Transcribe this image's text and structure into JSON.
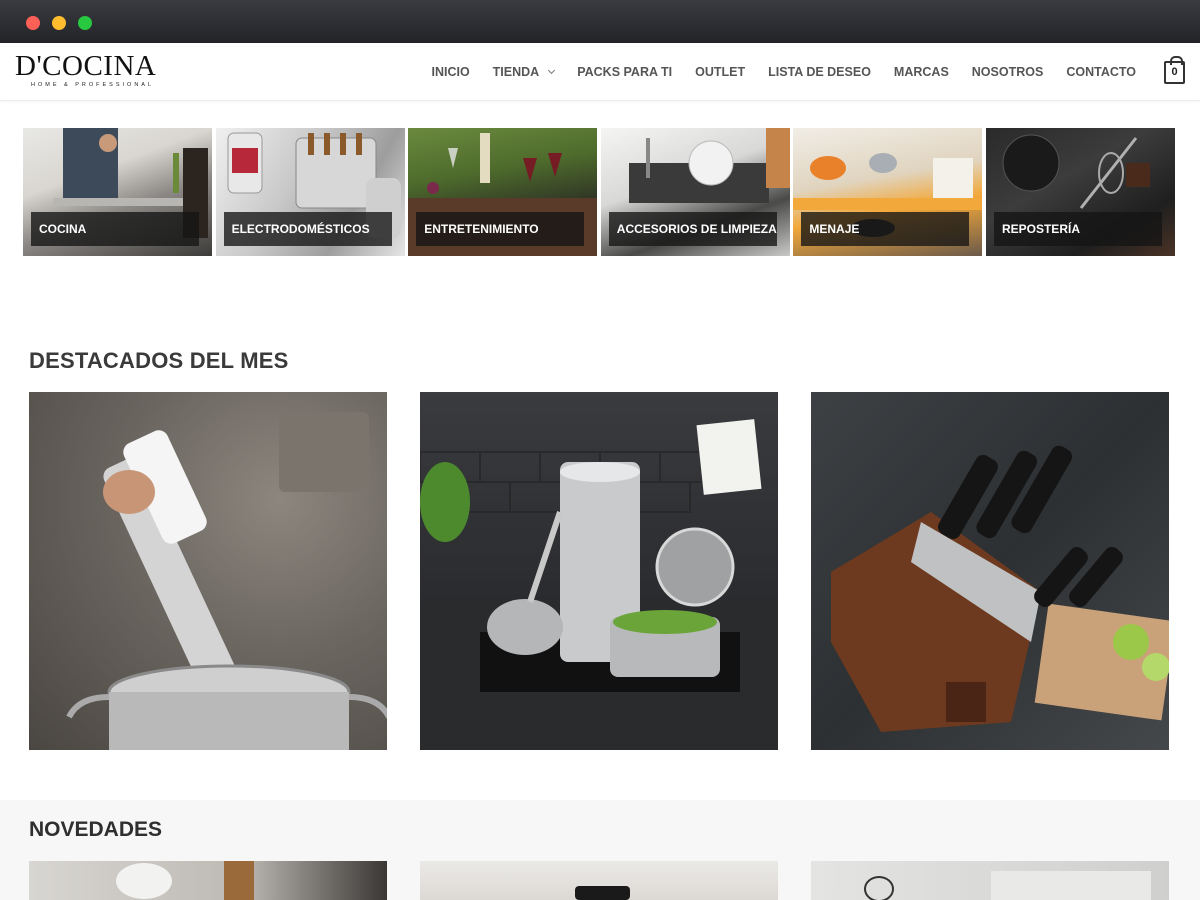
{
  "brand": {
    "name": "D'COCINA",
    "tagline": "HOME & PROFESSIONAL"
  },
  "nav": {
    "items": [
      {
        "label": "INICIO"
      },
      {
        "label": "TIENDA",
        "has_dropdown": true
      },
      {
        "label": "PACKS PARA TI"
      },
      {
        "label": "OUTLET"
      },
      {
        "label": "LISTA DE DESEO"
      },
      {
        "label": "MARCAS"
      },
      {
        "label": "NOSOTROS"
      },
      {
        "label": "CONTACTO"
      }
    ],
    "cart_count": "0"
  },
  "categories": [
    {
      "label": "COCINA"
    },
    {
      "label": "ELECTRODOMÉSTICOS"
    },
    {
      "label": "ENTRETENIMIENTO"
    },
    {
      "label": "ACCESORIOS DE LIMPIEZA"
    },
    {
      "label": "MENAJE"
    },
    {
      "label": "REPOSTERÍA"
    }
  ],
  "featured": {
    "title": "DESTACADOS DEL MES",
    "items": [
      {
        "image": "sous-vide-stick-in-pot"
      },
      {
        "image": "stainless-steel-cookware-set"
      },
      {
        "image": "knife-block-set"
      }
    ]
  },
  "novedades": {
    "title": "NOVEDADES",
    "items": [
      {
        "image": "kitchen-scene"
      },
      {
        "image": "appliance"
      },
      {
        "image": "whisk-utensils"
      }
    ]
  },
  "colors": {
    "header_bg": "#ffffff",
    "nav_text": "#555555",
    "tile_label_bg": "#141414",
    "section_band": "#f7f7f7"
  }
}
